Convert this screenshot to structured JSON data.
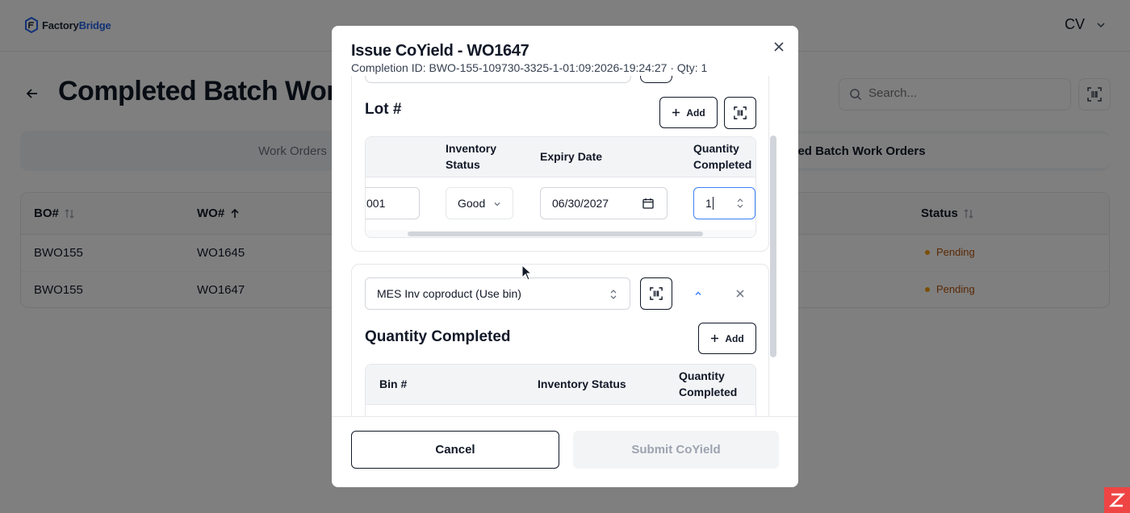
{
  "app": {
    "logo_text_a": "Factory",
    "logo_text_b": "Bridge",
    "user_initials": "CV"
  },
  "page": {
    "title": "Completed Batch Work Orders",
    "search_placeholder": "Search..."
  },
  "tabs": [
    {
      "label": "Work Orders",
      "active": false
    },
    {
      "label": "Completed Batch Work Orders",
      "active": true
    }
  ],
  "table": {
    "columns": [
      "BO#",
      "WO#",
      "Status"
    ],
    "rows": [
      {
        "bo": "BWO155",
        "wo": "WO1645",
        "status": "Pending"
      },
      {
        "bo": "BWO155",
        "wo": "WO1647",
        "status": "Pending"
      }
    ]
  },
  "modal": {
    "title": "Issue CoYield - WO1647",
    "subtitle": "Completion ID: BWO-155-109730-3325-1-01:09:2026-19:24:27 · Qty: 1",
    "lot_section": {
      "title": "Lot #",
      "add_label": "Add",
      "headers": {
        "inventory_status_1": "Inventory",
        "inventory_status_2": "Status",
        "expiry_date": "Expiry Date",
        "qty_completed_1": "Quantity",
        "qty_completed_2": "Completed"
      },
      "row": {
        "lot_value": "001",
        "inventory_status": "Good",
        "expiry_date": "06/30/2027",
        "quantity": "1"
      }
    },
    "coproduct_section": {
      "selected_item": "MES Inv coproduct (Use bin)",
      "title": "Quantity Completed",
      "add_label": "Add",
      "headers": {
        "bin": "Bin #",
        "inventory_status": "Inventory Status",
        "qty_completed_1": "Quantity",
        "qty_completed_2": "Completed"
      }
    },
    "cancel_label": "Cancel",
    "submit_label": "Submit CoYield"
  },
  "colors": {
    "pending": "#b45309",
    "pending_dot": "#f59e0b",
    "accent": "#2563eb",
    "badge": "#ef4444"
  }
}
